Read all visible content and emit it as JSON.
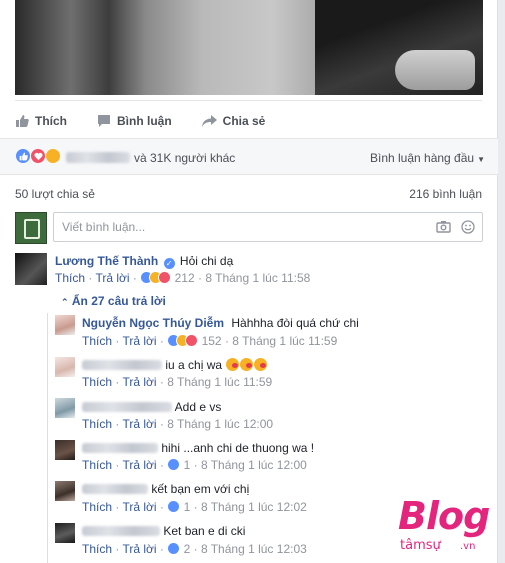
{
  "post": {
    "actions": {
      "like": "Thích",
      "comment": "Bình luận",
      "share": "Chia sẻ"
    },
    "reactions_text": "và 31K người khác",
    "sort_label": "Bình luận hàng đầu",
    "share_count": "50 lượt chia sẻ",
    "comment_count": "216 bình luận",
    "composer_placeholder": "Viết bình luận..."
  },
  "comments": [
    {
      "name": "Lương Thế Thành",
      "verified": true,
      "text": "Hỏi chi dạ",
      "like": "Thích",
      "reply": "Trả lời",
      "reactions": "212",
      "time": "8 Tháng 1 lúc 11:58"
    }
  ],
  "hide_replies": "Ẩn 27 câu trả lời",
  "replies": [
    {
      "name": "Nguyễn Ngọc Thúy Diễm",
      "text": "Hàhhha đòi quá chứ chi",
      "like": "Thích",
      "reply": "Trả lời",
      "reactions": "152",
      "time": "8 Tháng 1 lúc 11:59"
    },
    {
      "name": "",
      "text": "iu a chị wa",
      "like": "Thích",
      "reply": "Trả lời",
      "reactions": "",
      "time": "8 Tháng 1 lúc 11:59"
    },
    {
      "name": "",
      "text": "Add e vs",
      "like": "Thích",
      "reply": "Trả lời",
      "reactions": "",
      "time": "8 Tháng 1 lúc 12:00"
    },
    {
      "name": "",
      "text": "hihi ...anh chi de thuong wa !",
      "like": "Thích",
      "reply": "Trả lời",
      "reactions": "1",
      "time": "8 Tháng 1 lúc 12:00"
    },
    {
      "name": "",
      "text": "kết bạn em với chị",
      "like": "Thích",
      "reply": "Trả lời",
      "reactions": "1",
      "time": "8 Tháng 1 lúc 12:02"
    },
    {
      "name": "",
      "text": "Ket ban e di cki",
      "like": "Thích",
      "reply": "Trả lời",
      "reactions": "2",
      "time": "8 Tháng 1 lúc 12:03"
    }
  ],
  "watermark": {
    "brand": "Blog",
    "sub": "tâmsự",
    "tld": ".vn"
  },
  "colors": {
    "link": "#365899",
    "like_blue": "#5890ff",
    "love_red": "#f25268",
    "haha_yellow": "#f7b125",
    "watermark": "#e4257e"
  }
}
